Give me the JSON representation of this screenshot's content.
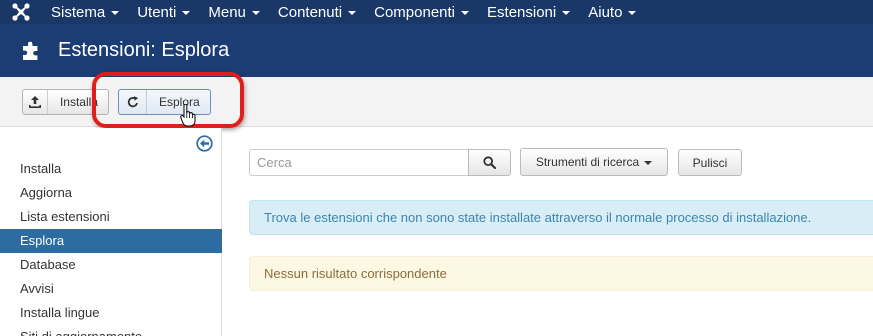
{
  "topnav": {
    "items": [
      {
        "label": "Sistema"
      },
      {
        "label": "Utenti"
      },
      {
        "label": "Menu"
      },
      {
        "label": "Contenuti"
      },
      {
        "label": "Componenti"
      },
      {
        "label": "Estensioni"
      },
      {
        "label": "Aiuto"
      }
    ]
  },
  "header": {
    "title": "Estensioni: Esplora",
    "icon": "puzzle-icon"
  },
  "toolbar": {
    "install_label": "Installa",
    "discover_label": "Esplora"
  },
  "sidebar": {
    "items": [
      {
        "label": "Installa"
      },
      {
        "label": "Aggiorna"
      },
      {
        "label": "Lista estensioni"
      },
      {
        "label": "Esplora",
        "active": true
      },
      {
        "label": "Database"
      },
      {
        "label": "Avvisi"
      },
      {
        "label": "Installa lingue"
      },
      {
        "label": "Siti di aggiornamento"
      }
    ]
  },
  "search": {
    "placeholder": "Cerca",
    "value": "",
    "tools_label": "Strumenti di ricerca",
    "clear_label": "Pulisci"
  },
  "messages": {
    "info": "Trova le estensioni che non sono state installate attraverso il normale processo di installazione.",
    "empty": "Nessun risultato corrispondente"
  },
  "colors": {
    "topnav_bg": "#1a3867",
    "header_bg": "#1c3d73",
    "active_item": "#2d6ca2",
    "highlight_ring": "#e01e1e"
  }
}
